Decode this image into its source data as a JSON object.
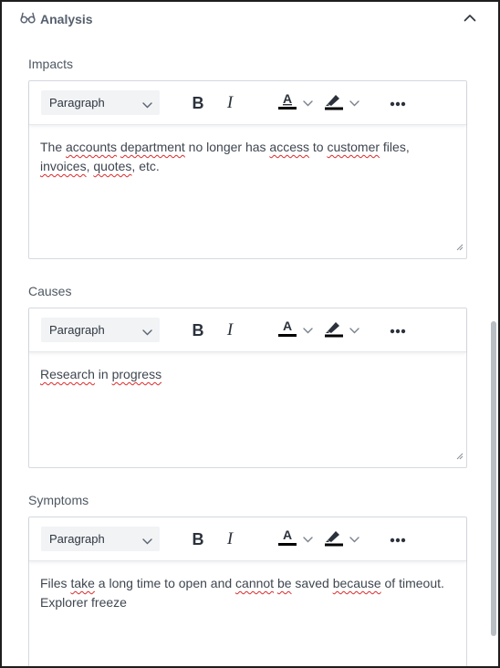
{
  "section": {
    "title": "Analysis",
    "icon": "glasses-icon",
    "collapse_icon": "chevron-up-icon"
  },
  "toolbar": {
    "paragraph_label": "Paragraph",
    "bold_label": "B",
    "italic_label": "I",
    "text_color_label": "A",
    "text_color": "#000000",
    "highlight_icon": "highlighter-icon",
    "more_icon": "more-dots-icon"
  },
  "fields": {
    "impacts": {
      "label": "Impacts",
      "text": "The accounts department no longer has access to customer files, invoices, quotes, etc.",
      "spellcheck_flagged": [
        "accounts",
        "department",
        "access",
        "customer",
        "invoices",
        "quotes"
      ]
    },
    "causes": {
      "label": "Causes",
      "text": "Research in progress",
      "spellcheck_flagged": [
        "Research",
        "progress"
      ]
    },
    "symptoms": {
      "label": "Symptoms",
      "text": "Files take a long time to open and cannot be saved because of timeout. Explorer freeze",
      "spellcheck_flagged": [
        "take",
        "cannot",
        "be",
        "because"
      ]
    }
  }
}
